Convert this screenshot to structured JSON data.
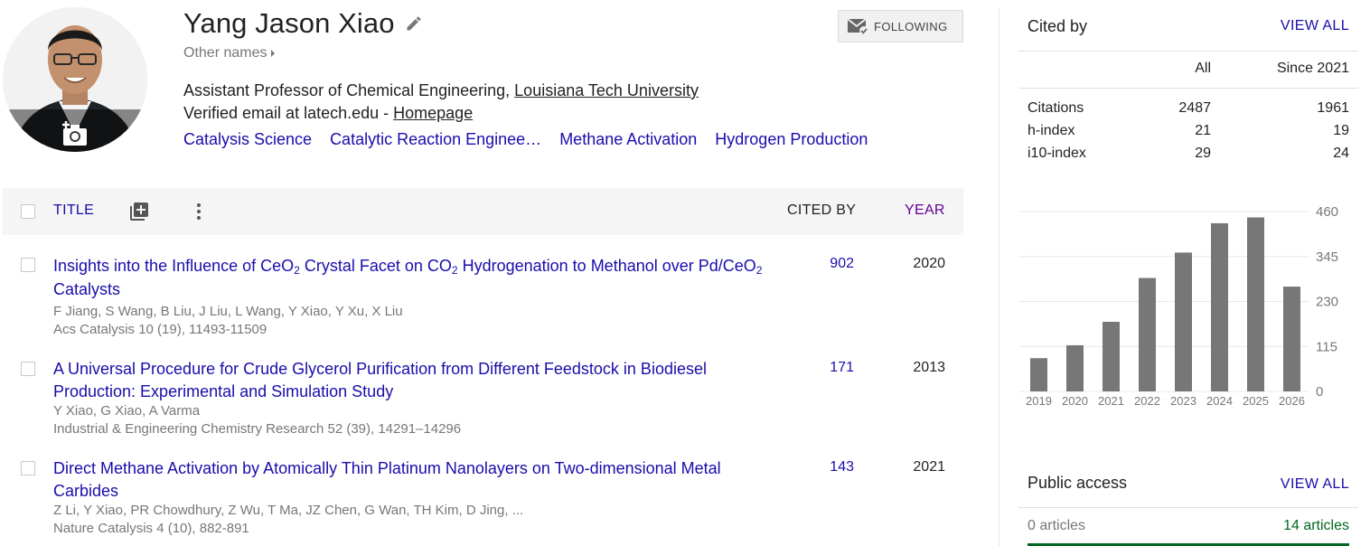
{
  "profile": {
    "name": "Yang Jason Xiao",
    "other_names": "Other names",
    "position": "Assistant Professor of Chemical Engineering, ",
    "institution": "Louisiana Tech University",
    "email": "Verified email at latech.edu - ",
    "homepage": "Homepage",
    "follow_label": "FOLLOWING",
    "interests": [
      "Catalysis Science",
      "Catalytic Reaction Enginee…",
      "Methane Activation",
      "Hydrogen Production"
    ]
  },
  "table": {
    "headers": {
      "title": "TITLE",
      "cited_by": "CITED BY",
      "year": "YEAR"
    },
    "articles": [
      {
        "title_parts": [
          "Insights into the Influence of CeO",
          "2",
          " Crystal Facet on CO",
          "2",
          " Hydrogenation to Methanol over Pd/CeO",
          "2",
          " Catalysts"
        ],
        "authors": "F Jiang, S Wang, B Liu, J Liu, L Wang, Y Xiao, Y Xu, X Liu",
        "venue": "Acs Catalysis 10 (19), 11493-11509",
        "cited_by": "902",
        "year": "2020"
      },
      {
        "title": "A Universal Procedure for Crude Glycerol Purification from Different Feedstock in Biodiesel Production: Experimental and Simulation Study",
        "authors": "Y Xiao, G Xiao, A Varma",
        "venue": "Industrial & Engineering Chemistry Research 52 (39), 14291–14296",
        "cited_by": "171",
        "year": "2013"
      },
      {
        "title": "Direct Methane Activation by Atomically Thin Platinum Nanolayers on Two-dimensional Metal Carbides",
        "authors": "Z Li, Y Xiao, PR Chowdhury, Z Wu, T Ma, JZ Chen, G Wan, TH Kim, D Jing, ...",
        "venue": "Nature Catalysis 4 (10), 882-891",
        "cited_by": "143",
        "year": "2021"
      }
    ]
  },
  "cited_by": {
    "title": "Cited by",
    "view_all": "VIEW ALL",
    "col_all": "All",
    "col_since": "Since 2021",
    "rows": [
      {
        "label": "Citations",
        "all": "2487",
        "since": "1961"
      },
      {
        "label": "h-index",
        "all": "21",
        "since": "19"
      },
      {
        "label": "i10-index",
        "all": "29",
        "since": "24"
      }
    ]
  },
  "chart_data": {
    "type": "bar",
    "categories": [
      "2019",
      "2020",
      "2021",
      "2022",
      "2023",
      "2024",
      "2025",
      "2026"
    ],
    "values": [
      85,
      118,
      178,
      290,
      355,
      430,
      445,
      268
    ],
    "yticks": [
      "460",
      "345",
      "230",
      "115",
      "0"
    ],
    "ylim": [
      0,
      460
    ],
    "bar_color": "#777777"
  },
  "public_access": {
    "title": "Public access",
    "view_all": "VIEW ALL",
    "unavailable": "0 articles",
    "available": "14 articles"
  }
}
